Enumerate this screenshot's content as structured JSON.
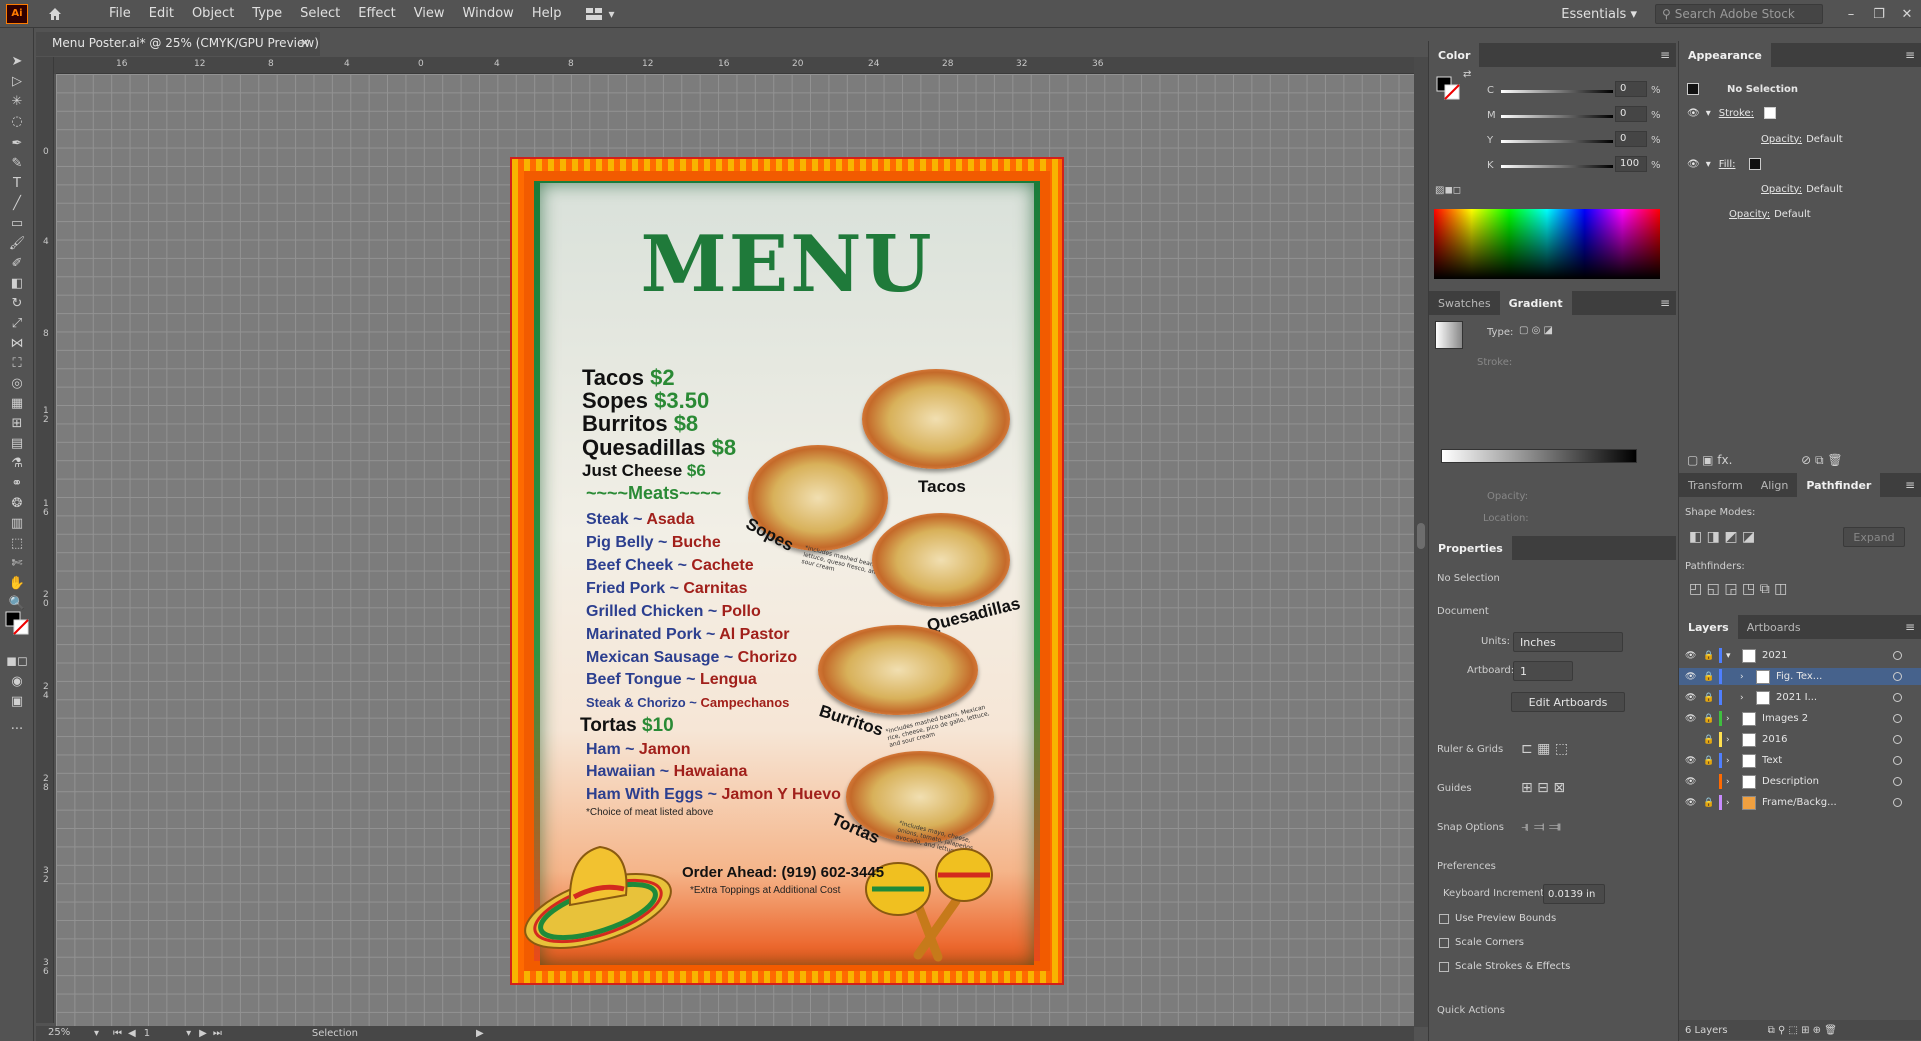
{
  "menubar": {
    "logo": "Ai",
    "items": [
      "File",
      "Edit",
      "Object",
      "Type",
      "Select",
      "Effect",
      "View",
      "Window",
      "Help"
    ],
    "workspace": "Essentials",
    "stock_search_placeholder": "Search Adobe Stock"
  },
  "document": {
    "tab_title": "Menu Poster.ai* @ 25% (CMYK/GPU Preview)",
    "zoom": "25%",
    "artboard_number": "1",
    "status": "Selection"
  },
  "ruler": {
    "top_labels": [
      "16",
      "12",
      "8",
      "4",
      "0",
      "4",
      "8",
      "12",
      "16",
      "20",
      "24",
      "28",
      "32",
      "36"
    ],
    "left_labels": [
      "0",
      "4",
      "8",
      "1\n2",
      "1\n6",
      "2\n0",
      "2\n4",
      "2\n8",
      "3\n2",
      "3\n6"
    ]
  },
  "poster": {
    "title": "MENU",
    "prices": [
      {
        "item": "Tacos",
        "price": "$2"
      },
      {
        "item": "Sopes",
        "price": "$3.50"
      },
      {
        "item": "Burritos",
        "price": "$8"
      },
      {
        "item": "Quesadillas",
        "price": "$8"
      },
      {
        "item": "Just Cheese",
        "price": "$6"
      }
    ],
    "meats_heading": "~~~~Meats~~~~",
    "meats": [
      {
        "en": "Steak",
        "es": "Asada"
      },
      {
        "en": "Pig Belly",
        "es": "Buche"
      },
      {
        "en": "Beef Cheek",
        "es": "Cachete"
      },
      {
        "en": "Fried Pork",
        "es": "Carnitas"
      },
      {
        "en": "Grilled Chicken",
        "es": "Pollo"
      },
      {
        "en": "Marinated Pork",
        "es": "Al Pastor"
      },
      {
        "en": "Mexican Sausage",
        "es": "Chorizo"
      },
      {
        "en": "Beef Tongue",
        "es": "Lengua"
      },
      {
        "en": "Steak & Chorizo",
        "es": "Campechanos"
      }
    ],
    "tortas_heading": {
      "item": "Tortas",
      "price": "$10"
    },
    "tortas": [
      {
        "en": "Ham",
        "es": "Jamon"
      },
      {
        "en": "Hawaiian",
        "es": "Hawaiana"
      },
      {
        "en": "Ham With Eggs",
        "es": "Jamon Y Huevo"
      }
    ],
    "choice_note": "*Choice of meat listed above",
    "order_ahead": "Order Ahead: (919) 602-3445",
    "extra_note": "*Extra Toppings at Additional Cost",
    "food_labels": [
      "Tacos",
      "Sopes",
      "Quesadillas",
      "Burritos",
      "Tortas"
    ],
    "captions": {
      "sopes": "*includes mashed beans, lettuce, queso fresco, and sour cream",
      "burritos": "*includes mashed beans, Mexican rice, cheese, pico de gallo, lettuce, and sour cream",
      "tortas": "*includes mayo, cheese, onions, tomato, jalapeños, avocado, and lettuce"
    }
  },
  "color_panel": {
    "title": "Color",
    "channels": [
      {
        "label": "C",
        "value": "0"
      },
      {
        "label": "M",
        "value": "0"
      },
      {
        "label": "Y",
        "value": "0"
      },
      {
        "label": "K",
        "value": "100"
      }
    ],
    "unit": "%"
  },
  "gradient_panel": {
    "tabs": [
      "Swatches",
      "Gradient"
    ],
    "type_label": "Type:",
    "stroke_label": "Stroke:",
    "opacity_label": "Opacity:",
    "location_label": "Location:"
  },
  "properties_panel": {
    "title": "Properties",
    "selection": "No Selection",
    "document_heading": "Document",
    "units_label": "Units:",
    "units_value": "Inches",
    "artboard_label": "Artboard:",
    "artboard_value": "1",
    "edit_artboards": "Edit Artboards",
    "ruler_grids": "Ruler & Grids",
    "guides": "Guides",
    "snap_options": "Snap Options",
    "preferences": "Preferences",
    "keyboard_increment_label": "Keyboard Increment:",
    "keyboard_increment_value": "0.0139 in",
    "checkboxes": [
      "Use Preview Bounds",
      "Scale Corners",
      "Scale Strokes & Effects"
    ],
    "quick_actions": "Quick Actions"
  },
  "appearance_panel": {
    "title": "Appearance",
    "selection": "No Selection",
    "stroke_label": "Stroke:",
    "opacity_label": "Opacity:",
    "opacity_value": "Default",
    "fill_label": "Fill:"
  },
  "pathfinder_panel": {
    "tabs": [
      "Transform",
      "Align",
      "Pathfinder"
    ],
    "shape_modes": "Shape Modes:",
    "pathfinders": "Pathfinders:",
    "expand": "Expand"
  },
  "layers_panel": {
    "tabs": [
      "Layers",
      "Artboards"
    ],
    "layers": [
      {
        "name": "2021",
        "color": "#4f7fff",
        "level": 0,
        "expanded": true,
        "selected": false
      },
      {
        "name": "Fig. Tex...",
        "color": "#4f7fff",
        "level": 1,
        "expanded": false,
        "selected": true
      },
      {
        "name": "2021 I...",
        "color": "#4f7fff",
        "level": 1,
        "expanded": false,
        "selected": false
      },
      {
        "name": "Images 2",
        "color": "#3fbf3f",
        "level": 0,
        "expanded": false,
        "selected": false
      },
      {
        "name": "2016",
        "color": "#ffe04f",
        "level": 0,
        "expanded": false,
        "selected": false
      },
      {
        "name": "Text",
        "color": "#4f7fff",
        "level": 0,
        "expanded": false,
        "selected": false
      },
      {
        "name": "Description",
        "color": "#ff6a00",
        "level": 0,
        "expanded": false,
        "selected": false
      },
      {
        "name": "Frame/Backg...",
        "color": "#c88bff",
        "level": 0,
        "expanded": false,
        "selected": false
      }
    ],
    "footer": "6 Layers"
  }
}
